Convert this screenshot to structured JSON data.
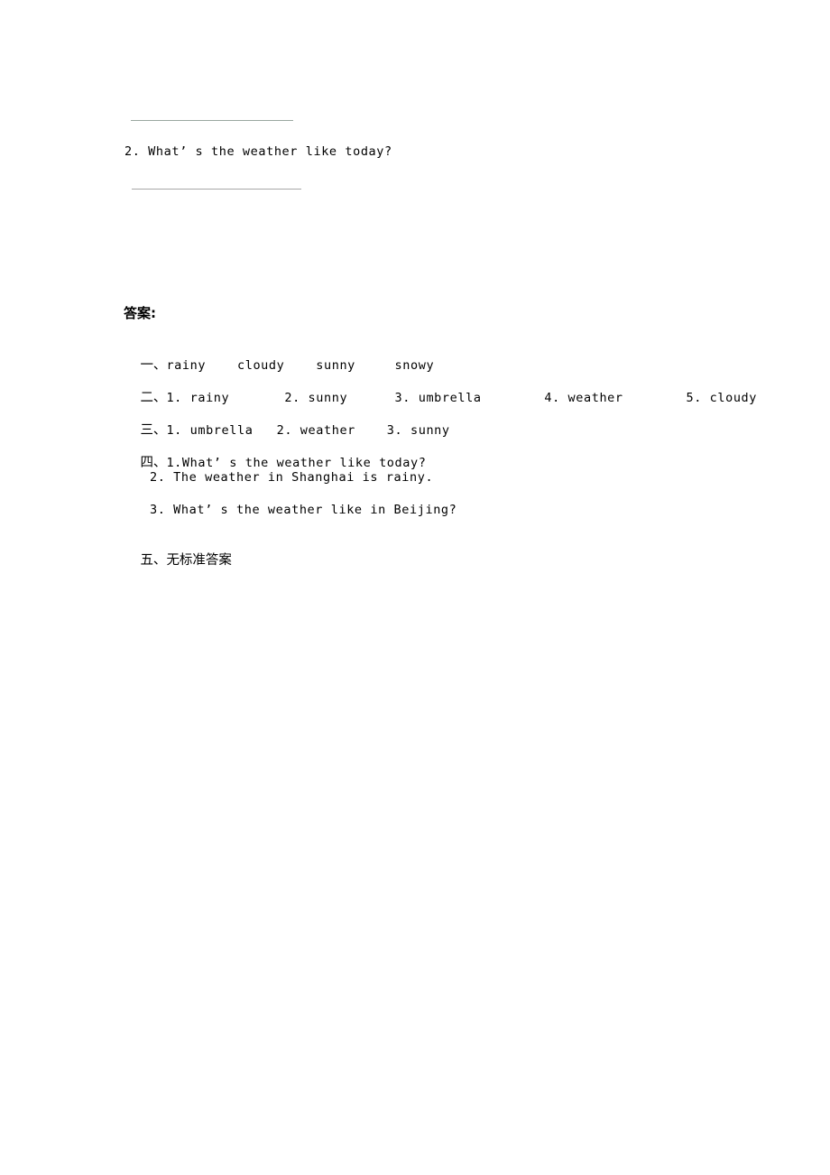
{
  "document": {
    "type": "worksheet-answer-key",
    "page_background": "#ffffff",
    "text_color": "#000000",
    "rule_color": "#9aa8a0"
  },
  "questions_tail": {
    "blank_rule_1": "",
    "item_2": "2. What’ s the weather like today?",
    "blank_rule_2": ""
  },
  "answers": {
    "heading": "答案:",
    "sections": [
      {
        "marker": "一、",
        "text": "rainy    cloudy    sunny     snowy"
      },
      {
        "marker": "二、",
        "text": "1. rainy       2. sunny      3. umbrella        4. weather        5. cloudy"
      },
      {
        "marker": "三、",
        "text": "1. umbrella   2. weather    3. sunny"
      },
      {
        "marker": "四、",
        "text": "1.What’ s the weather like today?"
      },
      {
        "marker": "五、",
        "text": "无标准答案"
      }
    ],
    "sub_items": [
      "2. The weather in Shanghai is rainy.",
      "3. What’ s the weather like in Beijing?"
    ]
  }
}
